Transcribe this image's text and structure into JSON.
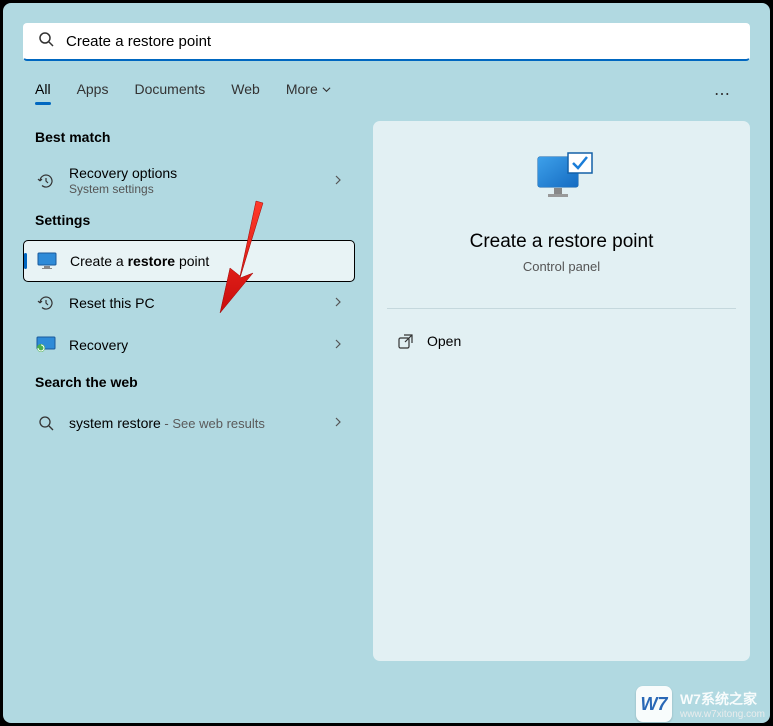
{
  "search": {
    "value": "Create a restore point"
  },
  "tabs": {
    "items": [
      "All",
      "Apps",
      "Documents",
      "Web",
      "More"
    ],
    "active_index": 0
  },
  "sections": {
    "best_match": "Best match",
    "settings": "Settings",
    "web": "Search the web"
  },
  "results": {
    "best": {
      "title": "Recovery options",
      "subtitle": "System settings"
    },
    "settings": [
      {
        "label_pre": "Create a ",
        "label_bold": "restore",
        "label_post": " point"
      },
      {
        "label": "Reset this PC"
      },
      {
        "label": "Recovery"
      }
    ],
    "web": {
      "label": "system restore",
      "suffix": " - See web results"
    }
  },
  "preview": {
    "title": "Create a restore point",
    "subtitle": "Control panel",
    "actions": {
      "open": "Open"
    }
  },
  "watermark": {
    "badge": "W7",
    "line1": "W7系统之家",
    "line2": "www.w7xitong.com"
  }
}
